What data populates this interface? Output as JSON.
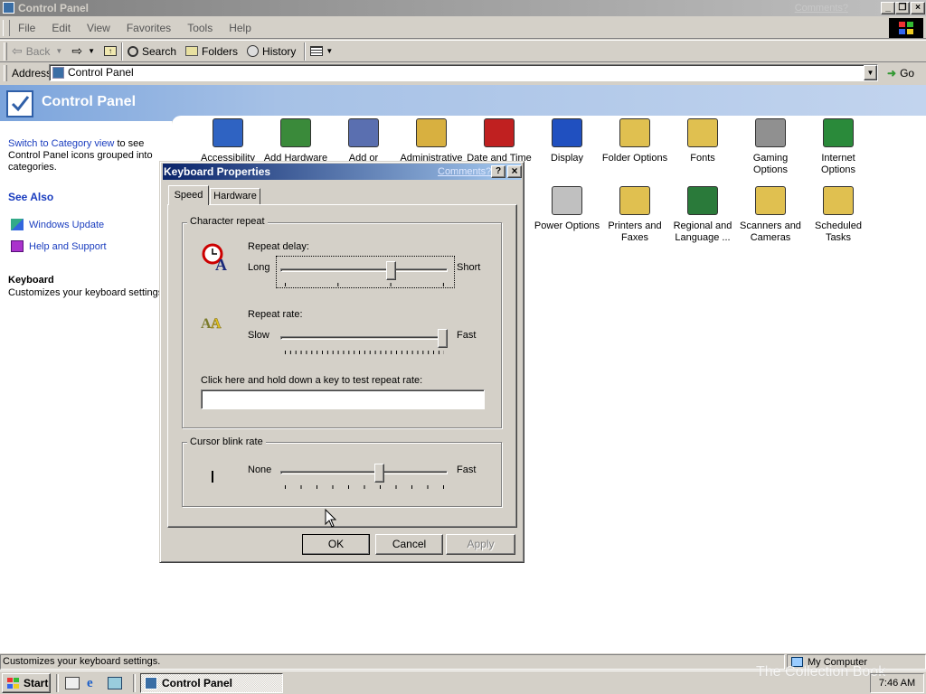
{
  "window": {
    "title": "Control Panel",
    "comments": "Comments?"
  },
  "menu": [
    "File",
    "Edit",
    "View",
    "Favorites",
    "Tools",
    "Help"
  ],
  "toolbar": {
    "back": "Back",
    "search": "Search",
    "folders": "Folders",
    "history": "History"
  },
  "address": {
    "label": "Address",
    "value": "Control Panel",
    "go": "Go"
  },
  "left": {
    "title": "Control Panel",
    "switch_link": "Switch to Category view",
    "switch_rest": " to see Control Panel icons grouped into categories.",
    "see_also": "See Also",
    "windows_update": "Windows Update",
    "help_support": "Help and Support",
    "detail_title": "Keyboard",
    "detail_desc": "Customizes your keyboard settings"
  },
  "icons": [
    {
      "label": "Accessibility",
      "icon": "accessibility-icon"
    },
    {
      "label": "Add Hardware",
      "icon": "add-hardware-icon"
    },
    {
      "label": "Add or",
      "icon": "add-remove-programs-icon"
    },
    {
      "label": "Administrative",
      "icon": "administrative-tools-icon"
    },
    {
      "label": "Date and Time",
      "icon": "date-time-icon"
    },
    {
      "label": "Display",
      "icon": "display-icon"
    },
    {
      "label": "Folder Options",
      "icon": "folder-options-icon"
    },
    {
      "label": "Fonts",
      "icon": "fonts-icon"
    },
    {
      "label": "Gaming Options",
      "icon": "gaming-options-icon"
    },
    {
      "label": "Internet Options",
      "icon": "internet-options-icon"
    },
    {
      "label": "Power Options",
      "icon": "power-options-icon"
    },
    {
      "label": "Printers and Faxes",
      "icon": "printers-faxes-icon"
    },
    {
      "label": "Regional and Language ...",
      "icon": "regional-language-icon"
    },
    {
      "label": "Scanners and Cameras",
      "icon": "scanners-cameras-icon"
    },
    {
      "label": "Scheduled Tasks",
      "icon": "scheduled-tasks-icon"
    }
  ],
  "dialog": {
    "title": "Keyboard Properties",
    "comments": "Comments?",
    "tabs": [
      "Speed",
      "Hardware"
    ],
    "char_repeat": "Character repeat",
    "repeat_delay": "Repeat delay:",
    "long": "Long",
    "short": "Short",
    "repeat_rate": "Repeat rate:",
    "slow": "Slow",
    "fast": "Fast",
    "test_label": "Click here and hold down a key to test repeat rate:",
    "test_value": "",
    "cursor_blink": "Cursor blink rate",
    "none": "None",
    "fast2": "Fast",
    "ok": "OK",
    "cancel": "Cancel",
    "apply": "Apply",
    "repeat_delay_level": 0.67,
    "repeat_rate_level": 1.0,
    "cursor_blink_level": 0.6
  },
  "status": {
    "text": "Customizes your keyboard settings.",
    "zone": "My Computer"
  },
  "taskbar": {
    "start": "Start",
    "task": "Control Panel",
    "clock": "7:46 AM",
    "watermark": "The Collection Book"
  }
}
